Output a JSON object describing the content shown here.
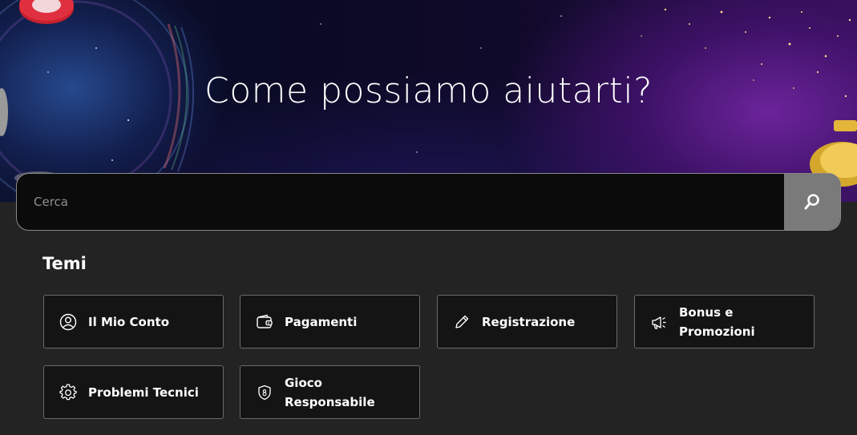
{
  "hero": {
    "title": "Come possiamo aiutarti?"
  },
  "search": {
    "placeholder": "Cerca",
    "button_icon": "search-icon"
  },
  "topics": {
    "title": "Temi",
    "items": [
      {
        "label": "Il Mio Conto",
        "icon": "user-circle-icon"
      },
      {
        "label": "Pagamenti",
        "icon": "wallet-icon"
      },
      {
        "label": "Registrazione",
        "icon": "pencil-icon"
      },
      {
        "label": "Bonus e Promozioni",
        "icon": "megaphone-icon"
      },
      {
        "label": "Problemi Tecnici",
        "icon": "gear-icon"
      },
      {
        "label": "Gioco Responsabile",
        "icon": "shield-18-icon"
      }
    ]
  },
  "colors": {
    "page_background": "#232323",
    "card_background": "#141414",
    "card_border": "#6a6a6a",
    "search_button": "#7a7a7a"
  }
}
